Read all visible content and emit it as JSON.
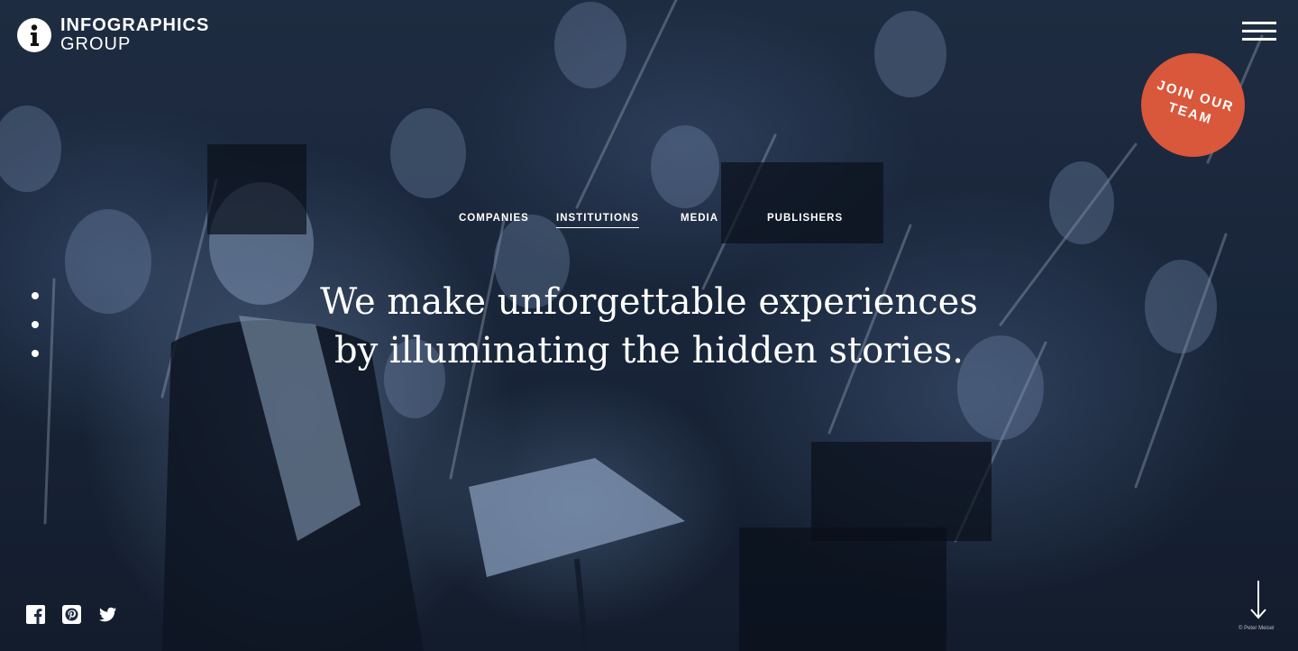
{
  "brand": {
    "line1": "INFOGRAPHICS",
    "line2": "GROUP"
  },
  "cta": {
    "label_line1": "JOIN OUR",
    "label_line2": "TEAM",
    "color": "#d9573a"
  },
  "nav": {
    "items": [
      {
        "label": "COMPANIES",
        "active": false
      },
      {
        "label": "INSTITUTIONS",
        "active": true
      },
      {
        "label": "MEDIA",
        "active": false
      },
      {
        "label": "PUBLISHERS",
        "active": false
      }
    ]
  },
  "hero": {
    "headline_line1": "We make unforgettable experiences",
    "headline_line2": "by illuminating the hidden stories.",
    "photo_credit": "© Peter Meisel",
    "slide_count": 3
  },
  "social": {
    "icons": [
      "facebook-icon",
      "pinterest-icon",
      "twitter-icon"
    ]
  },
  "icons": {
    "menu": "hamburger-menu-icon",
    "scroll": "arrow-down-icon",
    "logo": "info-i-icon"
  },
  "colors": {
    "tint_dark": "#1c2a40",
    "tint_light": "#7896be",
    "text": "#ffffff"
  }
}
